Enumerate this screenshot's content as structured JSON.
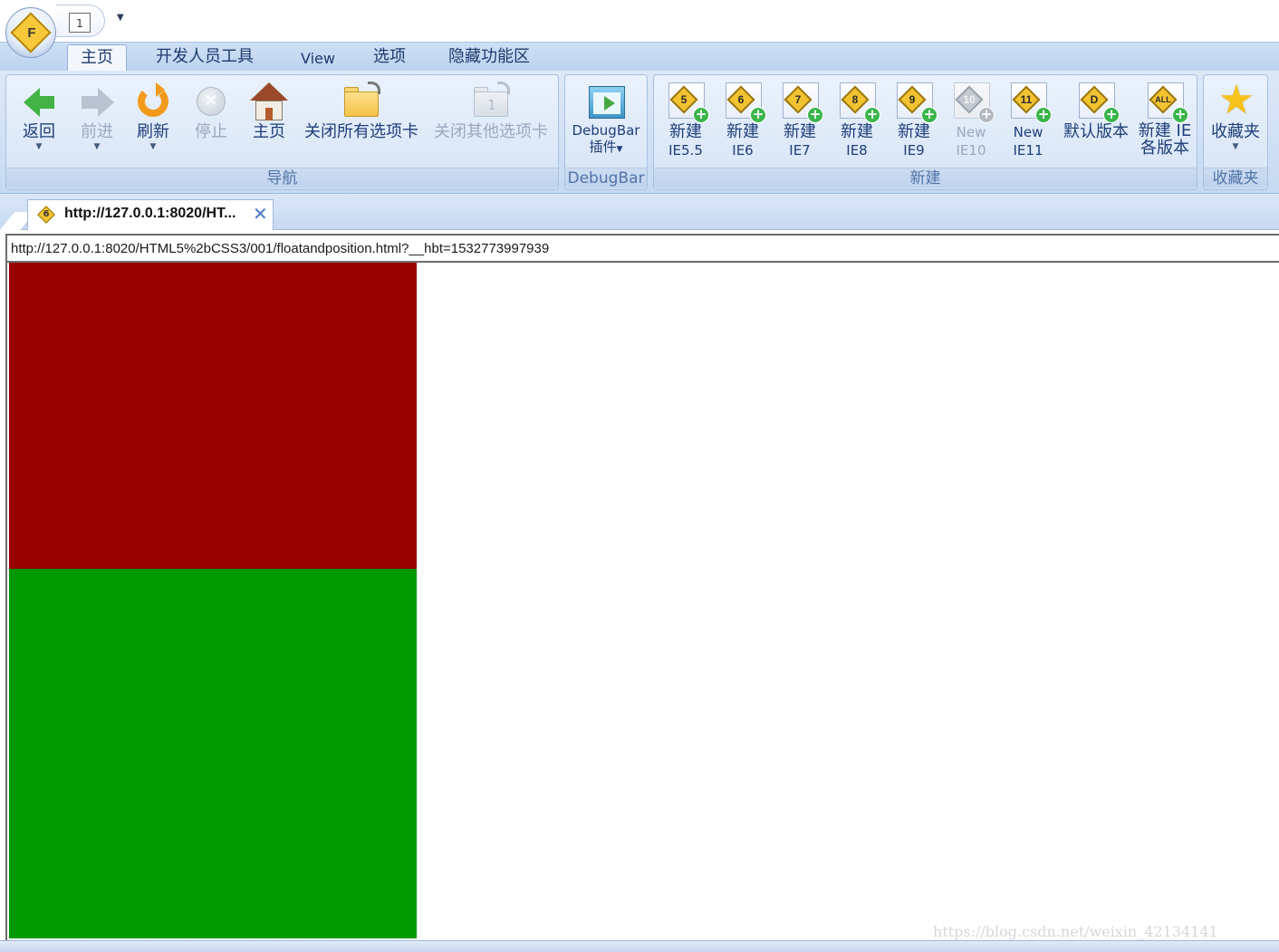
{
  "app": {
    "orb_letter": "F",
    "quick_access_number": "1",
    "quick_access_arrow": "▼"
  },
  "ribbon_tabs": [
    "主页",
    "开发人员工具",
    "View",
    "选项",
    "隐藏功能区"
  ],
  "groups": {
    "navigation": {
      "label": "导航",
      "buttons": {
        "back": "返回",
        "forward": "前进",
        "refresh": "刷新",
        "stop": "停止",
        "home": "主页",
        "close_all_tabs": "关闭所有选项卡",
        "close_other_tabs": "关闭其他选项卡"
      }
    },
    "debugbar": {
      "label": "DebugBar",
      "button_line1": "DebugBar",
      "button_line2": "插件"
    },
    "new": {
      "label": "新建",
      "buttons": [
        {
          "line1": "新建",
          "line2": "IE5.5",
          "icon_num": "5",
          "enabled": true
        },
        {
          "line1": "新建",
          "line2": "IE6",
          "icon_num": "6",
          "enabled": true
        },
        {
          "line1": "新建",
          "line2": "IE7",
          "icon_num": "7",
          "enabled": true
        },
        {
          "line1": "新建",
          "line2": "IE8",
          "icon_num": "8",
          "enabled": true
        },
        {
          "line1": "新建",
          "line2": "IE9",
          "icon_num": "9",
          "enabled": true
        },
        {
          "line1": "New",
          "line2": "IE10",
          "icon_num": "10",
          "enabled": false
        },
        {
          "line1": "New",
          "line2": "IE11",
          "icon_num": "11",
          "enabled": true
        },
        {
          "line1": "默认版本",
          "line2": "",
          "icon_num": "D",
          "enabled": true
        },
        {
          "line1": "新建 IE",
          "line2": "各版本",
          "icon_num": "ALL",
          "enabled": true
        }
      ]
    },
    "favorites": {
      "label": "收藏夹",
      "button": "收藏夹"
    }
  },
  "browser_tab": {
    "icon_num": "6",
    "title": "http://127.0.0.1:8020/HT...",
    "close": "✕"
  },
  "address": {
    "url": "http://127.0.0.1:8020/HTML5%2bCSS3/001/floatandposition.html?__hbt=1532773997939"
  },
  "page": {
    "red_box_color": "#990000",
    "green_box_color": "#009900"
  },
  "watermark": "https://blog.csdn.net/weixin_42134141"
}
